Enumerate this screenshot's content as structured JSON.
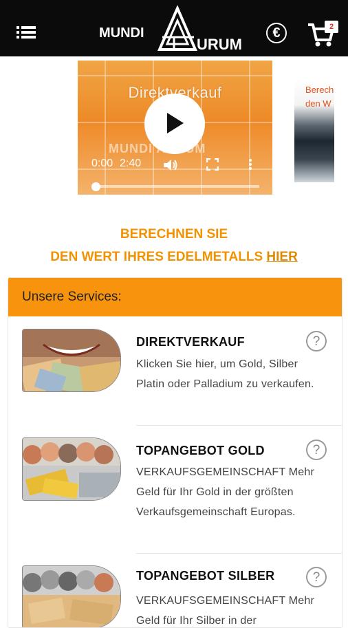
{
  "header": {
    "logo_left": "MUNDI",
    "logo_right": "URUM",
    "currency_symbol": "€",
    "cart_count": "2"
  },
  "video": {
    "title": "Direktverkauf",
    "watermark": "MUNDI  AURUM",
    "current_time": "0:00",
    "duration": "2:40",
    "progress": 0.0
  },
  "video2": {
    "text_line1": "Berech",
    "text_line2": "den W"
  },
  "calculator": {
    "line1": "BERECHNEN SIE",
    "line2": "DEN WERT IHRES EDELMETALLS",
    "link": "HIER"
  },
  "services": {
    "heading": "Unsere Services:",
    "items": [
      {
        "title": "DIREKTVERKAUF",
        "description": "Klicken Sie hier, um Gold, Silber Platin oder Palladium zu verkaufen."
      },
      {
        "title": "TOPANGEBOT GOLD",
        "description": "VERKAUFSGEMEINSCHAFT Mehr Geld für Ihr Gold in der größten Verkaufsgemeinschaft Europas."
      },
      {
        "title": "TOPANGEBOT SILBER",
        "description": "VERKAUFSGEMEINSCHAFT Mehr Geld für Ihr Silber in der"
      }
    ],
    "help_glyph": "?"
  },
  "colors": {
    "header_bg": "#0b0b0b",
    "accent_orange": "#f39200",
    "panel_orange": "#f7930c"
  }
}
